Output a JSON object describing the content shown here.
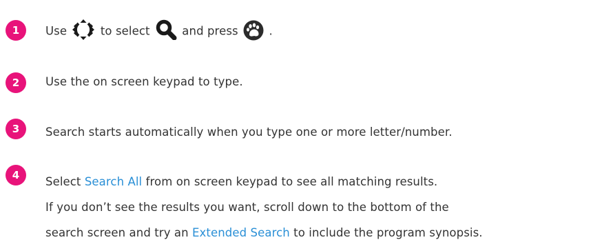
{
  "colors": {
    "badge": "#e8137a",
    "text": "#333333",
    "link": "#2a8fd6",
    "icon": "#1a1a1a"
  },
  "steps": [
    {
      "number": "1",
      "text_use": "Use",
      "text_to_select": "to select",
      "text_and_press": "and press",
      "text_end": ".",
      "icons": [
        "directional-pad-icon",
        "search-magnifier-icon",
        "paw-button-icon"
      ]
    },
    {
      "number": "2",
      "text": "Use the on screen keypad to type."
    },
    {
      "number": "3",
      "text": "Search starts automatically when you type one or more letter/number."
    },
    {
      "number": "4",
      "line1_before": "Select ",
      "line1_link": "Search All",
      "line1_after": " from on screen keypad to see all matching results.",
      "line2": "If you don’t see the results you want, scroll down to the bottom of the",
      "line3_before": "search screen and try an ",
      "line3_link": "Extended Search",
      "line3_after": " to include the program synopsis."
    }
  ]
}
